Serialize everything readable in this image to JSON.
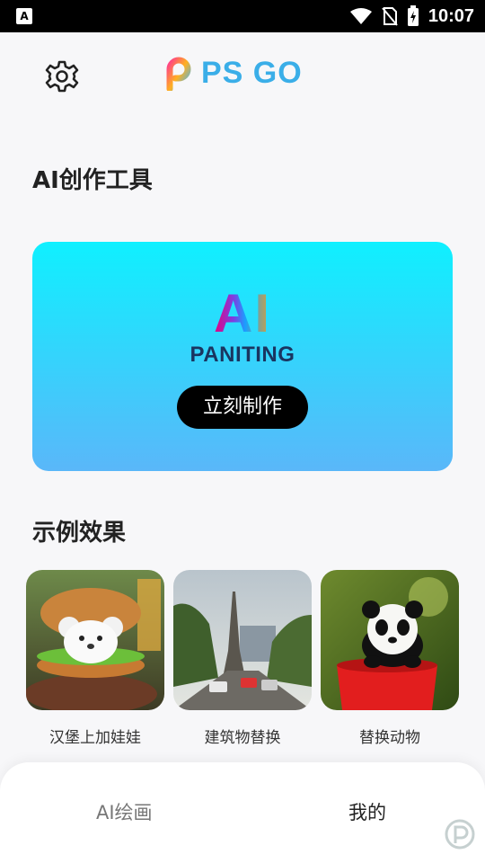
{
  "status_bar": {
    "time": "10:07",
    "left_icon_label": "A"
  },
  "header": {
    "logo_text": "PS GO",
    "icons": {
      "settings": "gear-icon",
      "logo": "ps-go-logo"
    }
  },
  "sections": {
    "tools_title": "AI创作工具",
    "examples_title": "示例效果"
  },
  "ai_card": {
    "logo_text": "AI",
    "subtitle": "PANITING",
    "button_label": "立刻制作",
    "gradient_top": "#0ff0ff",
    "gradient_bottom": "#5ab7f9"
  },
  "examples": [
    {
      "label": "汉堡上加娃娃"
    },
    {
      "label": "建筑物替换"
    },
    {
      "label": "替换动物"
    }
  ],
  "bottom_nav": {
    "tabs": [
      {
        "label": "AI绘画"
      },
      {
        "label": "我的"
      }
    ]
  }
}
